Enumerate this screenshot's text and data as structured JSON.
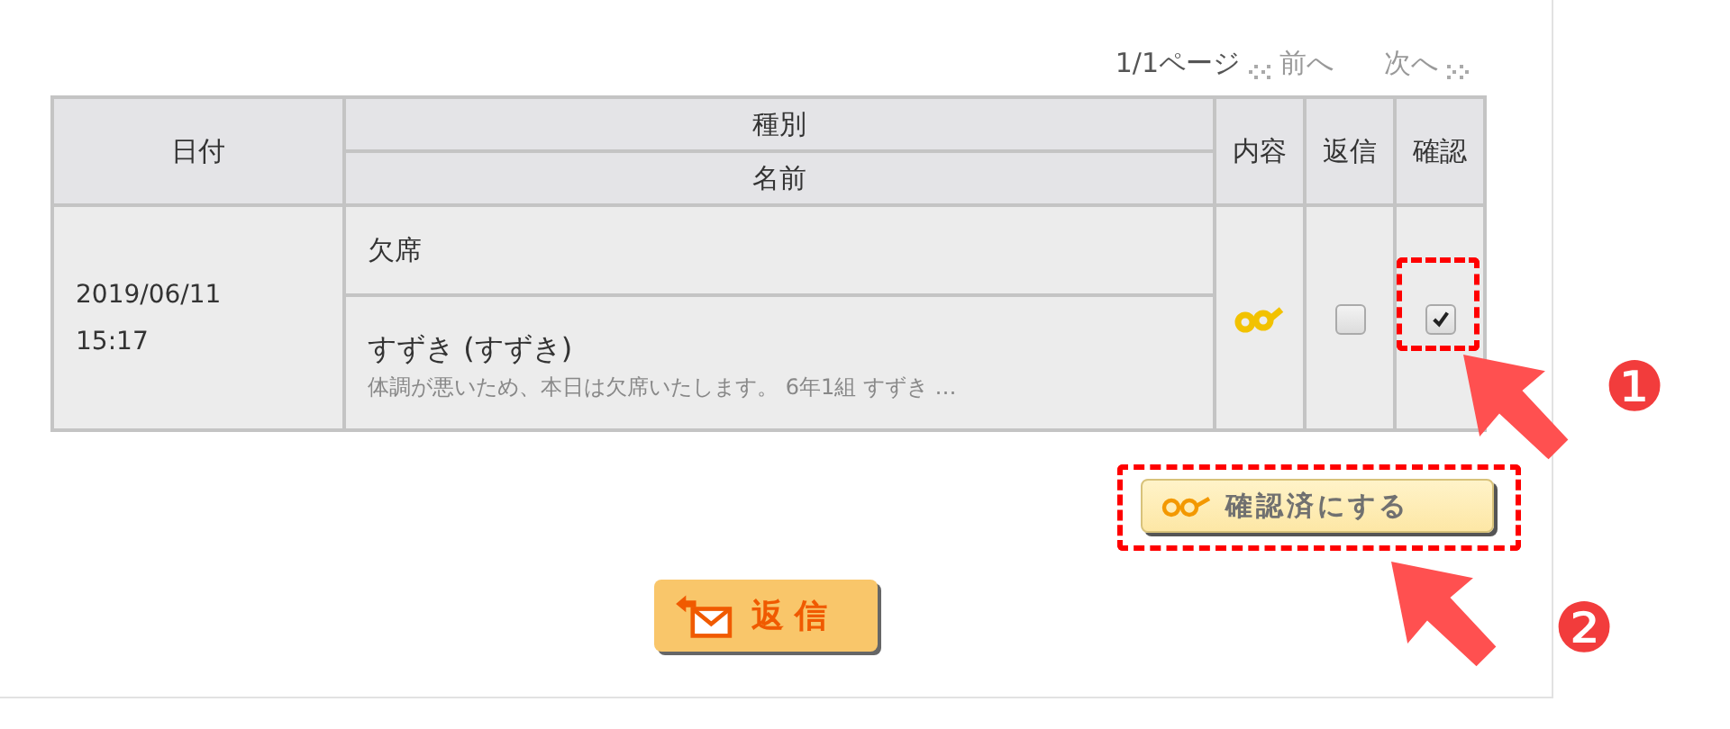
{
  "pager": {
    "page_info": "1/1ページ",
    "prev": "前へ",
    "next": "次へ"
  },
  "table": {
    "columns": {
      "date": "日付",
      "type": "種別",
      "name": "名前",
      "content": "内容",
      "reply": "返信",
      "confirm": "確認"
    },
    "rows": [
      {
        "date": "2019/06/11",
        "time": "15:17",
        "type": "欠席",
        "name": "すずき (すずき)",
        "preview": "体調が悪いため、本日は欠席いたします。 6年1組 すずき …",
        "reply_checked": false,
        "confirm_checked": true
      }
    ]
  },
  "confirm_button": "確認済にする",
  "reply_button": "返信",
  "annotations": [
    {
      "label": "❶"
    },
    {
      "label": "❷"
    }
  ]
}
